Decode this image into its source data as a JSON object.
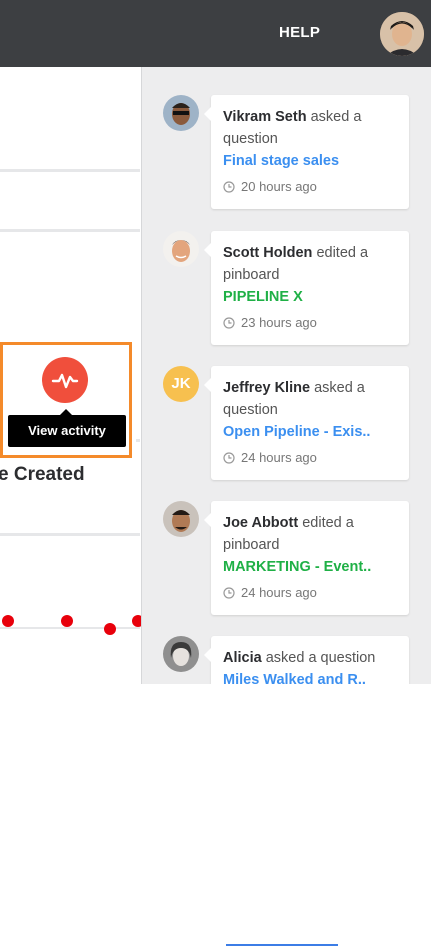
{
  "header": {
    "help_label": "HELP"
  },
  "main": {
    "tooltip_label": "View activity",
    "created_text": "e Created"
  },
  "colors": {
    "question_link": "#3b8ff0",
    "pinboard_link": "#1fb046",
    "accent": "#f04f3c",
    "highlight": "#f48a2a"
  },
  "activity_feed": [
    {
      "name": "Vikram Seth",
      "action": "asked a question",
      "link": "Final stage sales",
      "link_type": "question",
      "time": "20 hours ago"
    },
    {
      "name": "Scott Holden",
      "action": "edited a pinboard",
      "link": "PIPELINE X",
      "link_type": "pinboard",
      "time": "23 hours ago"
    },
    {
      "name": "Jeffrey Kline",
      "initials": "JK",
      "action": "asked a question",
      "link": "Open Pipeline - Exis..",
      "link_type": "question",
      "time": "24 hours ago"
    },
    {
      "name": "Joe Abbott",
      "action": "edited a pinboard",
      "link": "MARKETING - Event..",
      "link_type": "pinboard",
      "time": "24 hours ago"
    },
    {
      "name": "Alicia",
      "action": "asked a question",
      "link": "Miles Walked and R..",
      "link_type": "question",
      "time": ""
    }
  ]
}
